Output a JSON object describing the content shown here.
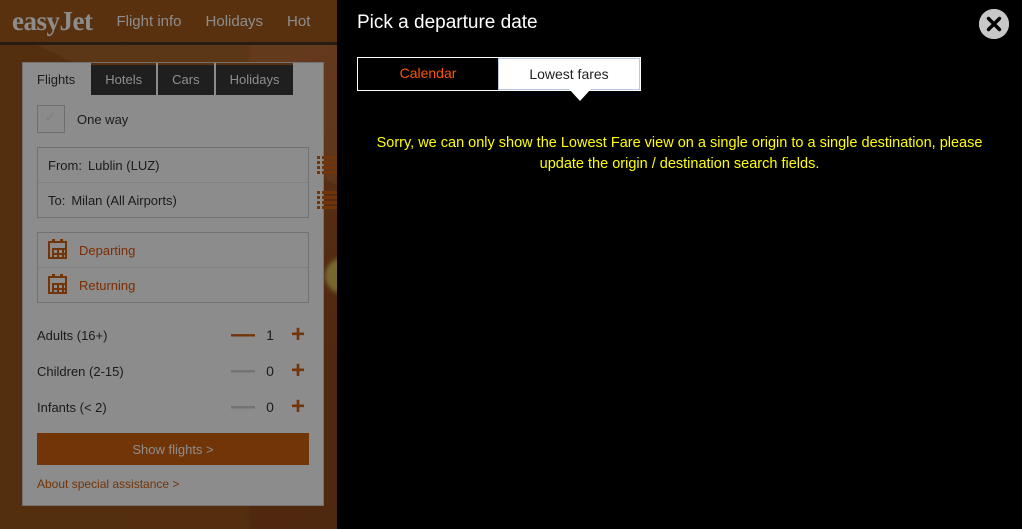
{
  "site": {
    "logo": "easyJet",
    "nav": [
      "Flight info",
      "Holidays",
      "Hot"
    ]
  },
  "search_panel": {
    "tabs": [
      {
        "label": "Flights",
        "active": true
      },
      {
        "label": "Hotels",
        "active": false
      },
      {
        "label": "Cars",
        "active": false
      },
      {
        "label": "Holidays",
        "active": false
      }
    ],
    "oneway_label": "One way",
    "from_label": "From:",
    "from_value": "Lublin (LUZ)",
    "to_label": "To:",
    "to_value": "Milan (All Airports)",
    "departing_label": "Departing",
    "returning_label": "Returning",
    "passengers": [
      {
        "label": "Adults (16+)",
        "count": "1",
        "minus_disabled": false
      },
      {
        "label": "Children (2-15)",
        "count": "0",
        "minus_disabled": true
      },
      {
        "label": "Infants (< 2)",
        "count": "0",
        "minus_disabled": true
      }
    ],
    "minus_symbol": "—",
    "plus_symbol": "+",
    "show_flights_label": "Show flights >",
    "assistance_label": "About special assistance >"
  },
  "modal": {
    "title": "Pick a departure date",
    "tabs": [
      {
        "label": "Calendar",
        "active": false
      },
      {
        "label": "Lowest fares",
        "active": true
      }
    ],
    "warning": "Sorry, we can only show the Lowest Fare view on a single origin to a single destination, please update the origin / destination search fields."
  },
  "colors": {
    "brand_orange": "#d0620f",
    "header_orange": "#a35a1b",
    "modal_bg": "#000000",
    "warning_yellow": "#ffff00",
    "tab_orange": "#ff5500"
  }
}
